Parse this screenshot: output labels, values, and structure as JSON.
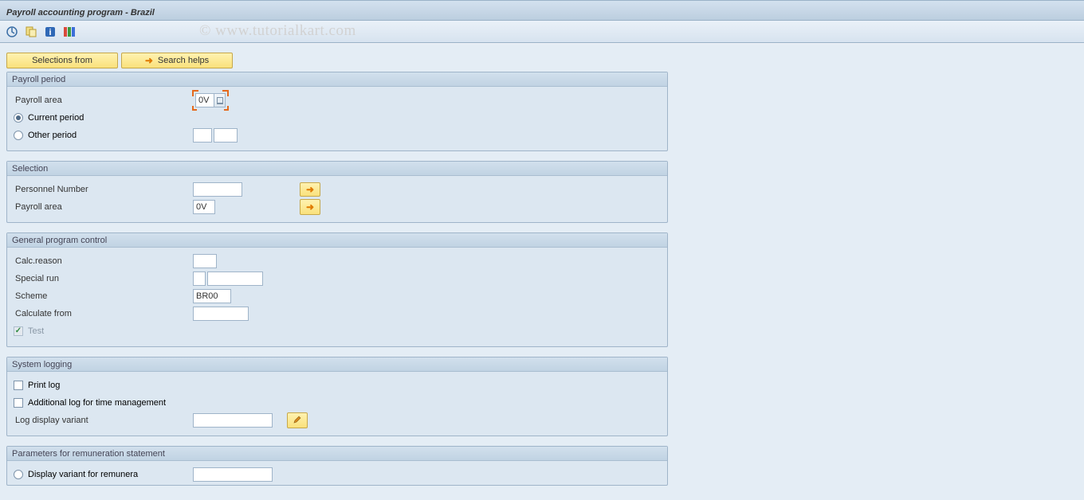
{
  "title": "Payroll accounting program  - Brazil",
  "watermark": "© www.tutorialkart.com",
  "toolbar_icons": [
    "execute-icon",
    "variant-icon",
    "info-icon",
    "abc-icon"
  ],
  "action_buttons": {
    "selections_from": "Selections from",
    "search_helps": "Search helps"
  },
  "groups": {
    "payroll_period": {
      "title": "Payroll period",
      "payroll_area_label": "Payroll area",
      "payroll_area_value": "0V",
      "current_period_label": "Current period",
      "other_period_label": "Other period",
      "other_period_from": "",
      "other_period_to": ""
    },
    "selection": {
      "title": "Selection",
      "personnel_number_label": "Personnel Number",
      "personnel_number_value": "",
      "payroll_area_label": "Payroll area",
      "payroll_area_value": "0V"
    },
    "general_program_control": {
      "title": "General program control",
      "calc_reason_label": "Calc.reason",
      "calc_reason_value": "",
      "special_run_label": "Special run",
      "special_run_value1": "",
      "special_run_value2": "",
      "scheme_label": "Scheme",
      "scheme_value": "BR00",
      "calculate_from_label": "Calculate from",
      "calculate_from_value": "",
      "test_label": "Test"
    },
    "system_logging": {
      "title": "System logging",
      "print_log_label": "Print log",
      "addl_log_label": "Additional log for time management",
      "log_display_variant_label": "Log display variant",
      "log_display_variant_value": ""
    },
    "parameters_remuneration": {
      "title": "Parameters for remuneration statement",
      "display_variant_label": "Display variant for remunera",
      "display_variant_value": ""
    }
  }
}
